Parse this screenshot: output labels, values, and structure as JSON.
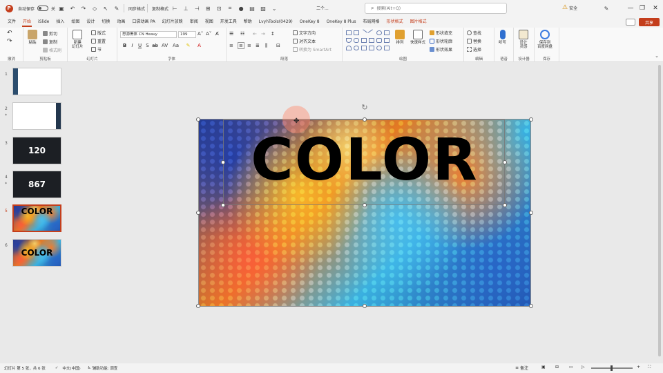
{
  "titlebar": {
    "autosave_label": "自动保存",
    "autosave_state": "关",
    "quick_tools": [
      "同步格式",
      "复制格式"
    ],
    "doc_title": "二个...",
    "search_placeholder": "搜索(Alt+Q)",
    "warning_label": "安全",
    "accent_color": "#c43e1c"
  },
  "tabs": [
    {
      "label": "文件"
    },
    {
      "label": "开始"
    },
    {
      "label": "iSlide"
    },
    {
      "label": "插入"
    },
    {
      "label": "绘图"
    },
    {
      "label": "设计"
    },
    {
      "label": "切换"
    },
    {
      "label": "动画"
    },
    {
      "label": "口袋动画 PA"
    },
    {
      "label": "幻灯片放映"
    },
    {
      "label": "审阅"
    },
    {
      "label": "视图"
    },
    {
      "label": "开发工具"
    },
    {
      "label": "帮助"
    },
    {
      "label": "LvyhTools(0429)"
    },
    {
      "label": "OneKey 8"
    },
    {
      "label": "OneKey 8 Plus"
    },
    {
      "label": "布局网格"
    },
    {
      "label": "形状格式"
    },
    {
      "label": "图片格式"
    }
  ],
  "share_label": "共享",
  "ribbon": {
    "groups": {
      "undo": "撤消",
      "clipboard": "剪贴板",
      "slides": "幻灯片",
      "font": "字体",
      "paragraph": "段落",
      "drawing": "绘图",
      "editing": "编辑",
      "voice": "语音",
      "designer": "设计器",
      "save": "保存"
    },
    "clipboard": {
      "paste": "粘贴",
      "cut": "剪切",
      "copy": "复制",
      "format_painter": "格式刷"
    },
    "slides": {
      "new_slide": "新建\n幻灯片",
      "layout": "版式",
      "reset": "重置",
      "section": "节"
    },
    "font": {
      "font_name": "思源黑体 CN Heavy",
      "font_size": "199"
    },
    "paragraph": {
      "text_direction": "文字方向",
      "align_text": "对齐文本",
      "smartart": "转换为 SmartArt"
    },
    "drawing": {
      "arrange": "排列",
      "quick_styles": "快速样式",
      "shape_fill": "形状填充",
      "shape_outline": "形状轮廓",
      "shape_effects": "形状效果"
    },
    "editing": {
      "find": "查找",
      "replace": "替换",
      "select": "选择"
    },
    "voice": {
      "dictate": "听写"
    },
    "designer": {
      "label": "设计\n灵感"
    },
    "save": {
      "label": "保存到\n百度网盘"
    }
  },
  "slides": [
    {
      "number": "1",
      "text": "",
      "star": false
    },
    {
      "number": "2",
      "text": "",
      "star": true
    },
    {
      "number": "3",
      "text": "120",
      "star": false
    },
    {
      "number": "4",
      "text": "867",
      "star": true
    },
    {
      "number": "5",
      "text": "COLOR",
      "star": false,
      "selected": true
    },
    {
      "number": "6",
      "text": "COLOR",
      "star": false
    }
  ],
  "slide_main": {
    "title": "COLOR"
  },
  "statusbar": {
    "slide_info": "幻灯片 第 5 张，共 6 张",
    "language": "中文(中国)",
    "accessibility": "辅助功能: 调查",
    "notes": "备注"
  }
}
